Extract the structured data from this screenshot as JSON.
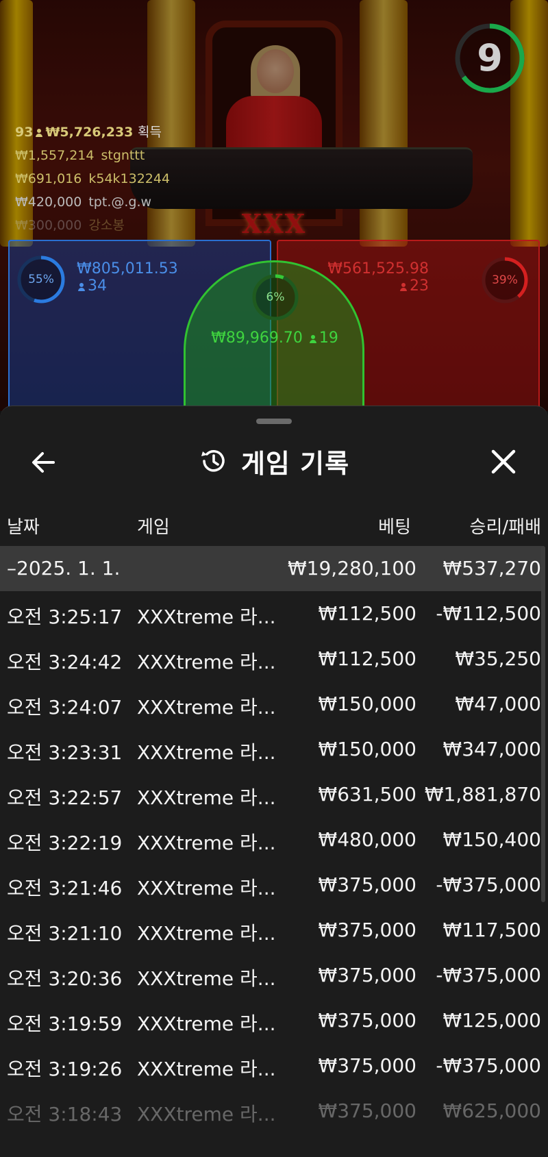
{
  "stream": {
    "logo_text": "XXX",
    "timer": "9",
    "winners": {
      "count": "93",
      "total": "₩5,726,233",
      "total_label": "획득",
      "list": [
        {
          "amount": "₩1,557,214",
          "name": "stgnttt"
        },
        {
          "amount": "₩691,016",
          "name": "k54k132244"
        },
        {
          "amount": "₩420,000",
          "name": "tpt.@.g.w"
        },
        {
          "amount": "₩300,000",
          "name": "강소봉"
        }
      ]
    },
    "bets": {
      "player": {
        "percent": "55%",
        "amount": "₩805,011.53",
        "players": "34",
        "color": "#2b7be0"
      },
      "banker": {
        "percent": "39%",
        "amount": "₩561,525.98",
        "players": "23",
        "color": "#d42020"
      },
      "tie": {
        "percent": "6%",
        "amount": "₩89,969.70",
        "players": "19",
        "color": "#36c836"
      }
    }
  },
  "sheet": {
    "title": "게임 기록",
    "back_icon": "arrow-left-icon",
    "history_icon": "history-icon",
    "close_icon": "close-icon",
    "columns": {
      "date": "날짜",
      "game": "게임",
      "bet": "베팅",
      "win": "승리/패배"
    },
    "summary": {
      "date": "–2025. 1. 1.",
      "game": "",
      "bet": "₩19,280,100",
      "win": "₩537,270"
    },
    "rows": [
      {
        "date": "오전 3:25:17",
        "game": "XXXtreme 라...",
        "bet": "₩112,500",
        "win": "-₩112,500"
      },
      {
        "date": "오전 3:24:42",
        "game": "XXXtreme 라...",
        "bet": "₩112,500",
        "win": "₩35,250"
      },
      {
        "date": "오전 3:24:07",
        "game": "XXXtreme 라...",
        "bet": "₩150,000",
        "win": "₩47,000"
      },
      {
        "date": "오전 3:23:31",
        "game": "XXXtreme 라...",
        "bet": "₩150,000",
        "win": "₩347,000"
      },
      {
        "date": "오전 3:22:57",
        "game": "XXXtreme 라...",
        "bet": "₩631,500",
        "win": "₩1,881,870"
      },
      {
        "date": "오전 3:22:19",
        "game": "XXXtreme 라...",
        "bet": "₩480,000",
        "win": "₩150,400"
      },
      {
        "date": "오전 3:21:46",
        "game": "XXXtreme 라...",
        "bet": "₩375,000",
        "win": "-₩375,000"
      },
      {
        "date": "오전 3:21:10",
        "game": "XXXtreme 라...",
        "bet": "₩375,000",
        "win": "₩117,500"
      },
      {
        "date": "오전 3:20:36",
        "game": "XXXtreme 라...",
        "bet": "₩375,000",
        "win": "-₩375,000"
      },
      {
        "date": "오전 3:19:59",
        "game": "XXXtreme 라...",
        "bet": "₩375,000",
        "win": "₩125,000"
      },
      {
        "date": "오전 3:19:26",
        "game": "XXXtreme 라...",
        "bet": "₩375,000",
        "win": "-₩375,000"
      },
      {
        "date": "오전 3:18:43",
        "game": "XXXtreme 라...",
        "bet": "₩375,000",
        "win": "₩625,000"
      }
    ]
  }
}
